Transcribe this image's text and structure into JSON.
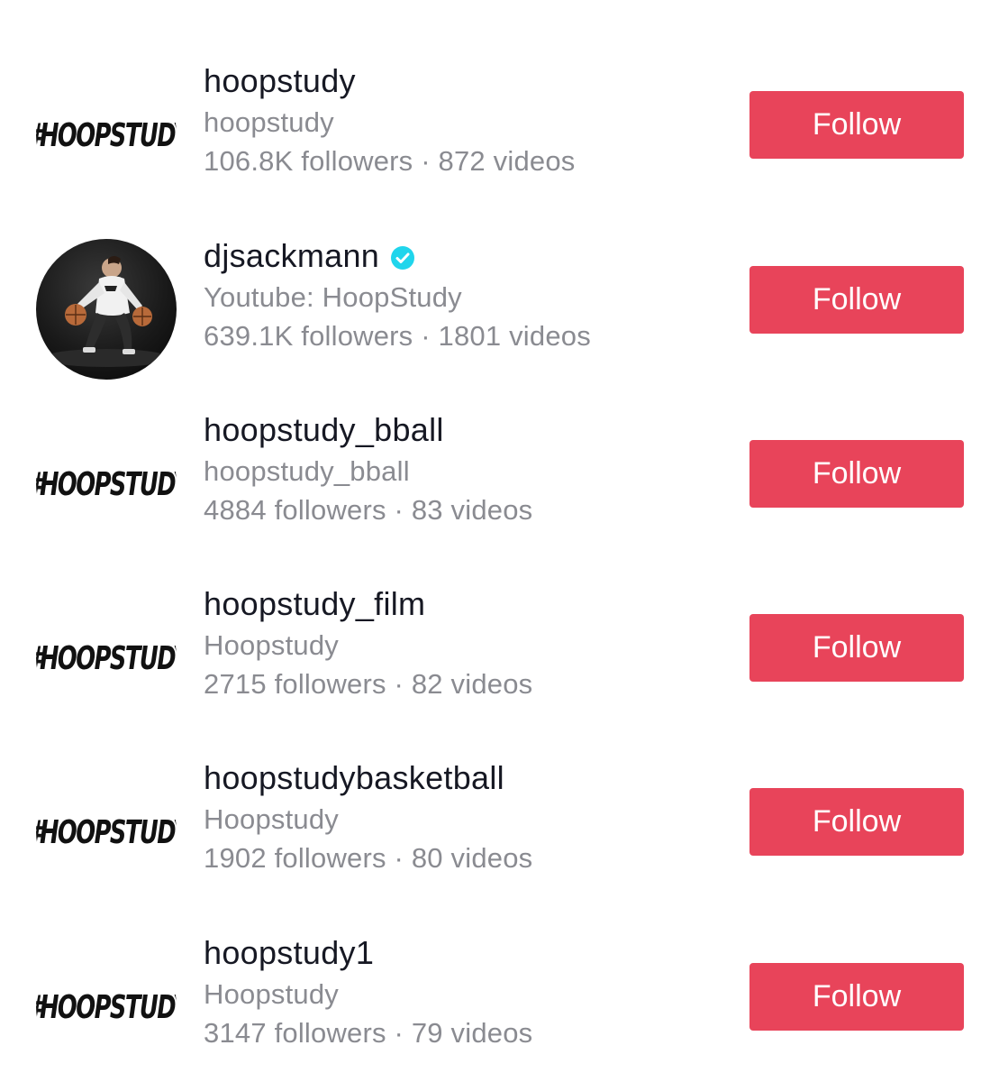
{
  "users": [
    {
      "username": "hoopstudy",
      "nickname": "hoopstudy",
      "stats": "106.8K followers · 872 videos",
      "followers": "106.8K",
      "videos": "872",
      "verified": false,
      "avatar_type": "logo",
      "avatar_text": "#HOOPSTUDY",
      "follow_label": "Follow"
    },
    {
      "username": "djsackmann",
      "nickname": "Youtube: HoopStudy",
      "stats": "639.1K followers · 1801 videos",
      "followers": "639.1K",
      "videos": "1801",
      "verified": true,
      "avatar_type": "photo",
      "avatar_text": "",
      "follow_label": "Follow"
    },
    {
      "username": "hoopstudy_bball",
      "nickname": "hoopstudy_bball",
      "stats": "4884 followers · 83 videos",
      "followers": "4884",
      "videos": "83",
      "verified": false,
      "avatar_type": "logo",
      "avatar_text": "#HOOPSTUDY",
      "follow_label": "Follow"
    },
    {
      "username": "hoopstudy_film",
      "nickname": "Hoopstudy",
      "stats": "2715 followers · 82 videos",
      "followers": "2715",
      "videos": "82",
      "verified": false,
      "avatar_type": "logo",
      "avatar_text": "#HOOPSTUDY",
      "follow_label": "Follow"
    },
    {
      "username": "hoopstudybasketball",
      "nickname": "Hoopstudy",
      "stats": "1902 followers · 80 videos",
      "followers": "1902",
      "videos": "80",
      "verified": false,
      "avatar_type": "logo",
      "avatar_text": "#HOOPSTUDY",
      "follow_label": "Follow"
    },
    {
      "username": "hoopstudy1",
      "nickname": "Hoopstudy",
      "stats": "3147 followers · 79 videos",
      "followers": "3147",
      "videos": "79",
      "verified": false,
      "avatar_type": "logo",
      "avatar_text": "#HOOPSTUDY",
      "follow_label": "Follow"
    }
  ],
  "colors": {
    "follow_button": "#e8445a",
    "username": "#161823",
    "secondary_text": "#8a8b91",
    "verified_badge": "#20d5ec"
  },
  "icons": {
    "verified": "verified-check-icon"
  }
}
